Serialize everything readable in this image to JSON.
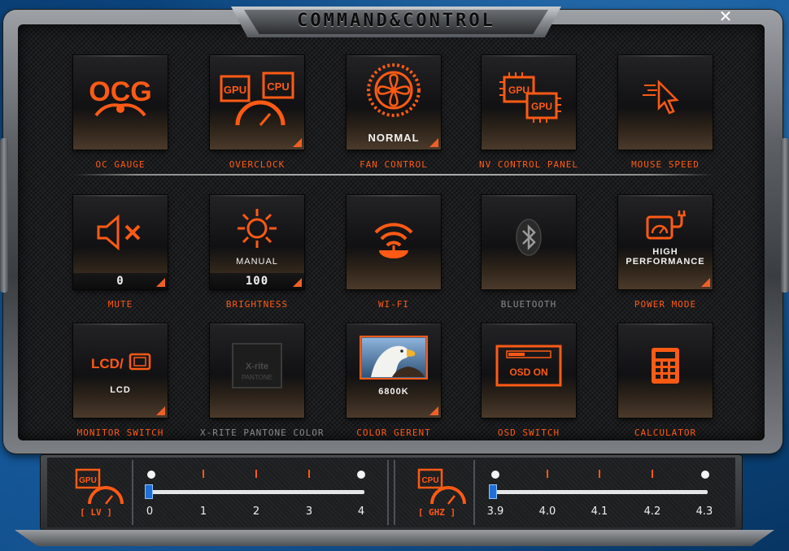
{
  "window": {
    "title": "COMMAND&CONTROL",
    "close_label": "✕"
  },
  "colors": {
    "accent": "#ff5a14",
    "panel": "#1b1c1e",
    "slider_thumb": "#1f6fd6"
  },
  "tiles": [
    {
      "label": "OC GAUGE",
      "icon": "ocg-logo-icon",
      "icon_text": "OCG"
    },
    {
      "label": "OVERCLOCK",
      "icon": "overclock-gauge-icon",
      "gpu": "GPU",
      "cpu": "CPU"
    },
    {
      "label": "FAN CONTROL",
      "icon": "fan-icon",
      "value": "NORMAL"
    },
    {
      "label": "NV CONTROL PANEL",
      "icon": "dual-gpu-icon",
      "gpu1": "GPU",
      "gpu2": "GPU"
    },
    {
      "label": "MOUSE SPEED",
      "icon": "cursor-speed-icon"
    },
    {
      "label": "MUTE",
      "icon": "speaker-mute-icon",
      "value": "0"
    },
    {
      "label": "BRIGHTNESS",
      "icon": "sun-icon",
      "mode": "MANUAL",
      "value": "100"
    },
    {
      "label": "WI-FI",
      "icon": "wifi-icon"
    },
    {
      "label": "BLUETOOTH",
      "icon": "bluetooth-icon",
      "disabled": true
    },
    {
      "label": "POWER MODE",
      "icon": "power-plug-icon",
      "value_line1": "HIGH",
      "value_line2": "PERFORMANCE"
    },
    {
      "label": "MONITOR SWITCH",
      "icon": "lcd-switch-icon",
      "icon_text": "LCD/",
      "value": "LCD"
    },
    {
      "label": "X-RITE PANTONE COLOR",
      "icon": "xrite-pantone-logo-icon",
      "logo_line1": "X-rite",
      "logo_line2": "PANTONE"
    },
    {
      "label": "COLOR GERENT",
      "icon": "eagle-photo-icon",
      "value": "6800K"
    },
    {
      "label": "OSD SWITCH",
      "icon": "osd-display-icon",
      "icon_text": "OSD ON"
    },
    {
      "label": "CALCULATOR",
      "icon": "calculator-icon"
    }
  ],
  "gpu_slider": {
    "icon": "gpu-gauge-icon",
    "icon_text": "GPU",
    "unit": "[ LV ]",
    "ticks": [
      "0",
      "1",
      "2",
      "3",
      "4"
    ],
    "value": "0"
  },
  "cpu_slider": {
    "icon": "cpu-gauge-icon",
    "icon_text": "CPU",
    "unit": "[ GHZ ]",
    "ticks": [
      "3.9",
      "4.0",
      "4.1",
      "4.2",
      "4.3"
    ],
    "value": "3.9"
  }
}
